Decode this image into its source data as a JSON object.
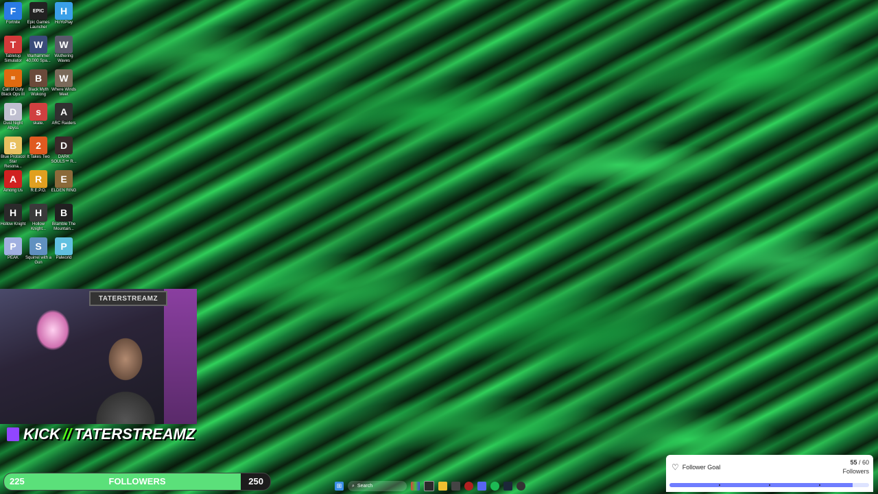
{
  "desktop": {
    "icons": [
      {
        "label": "Fortnite",
        "glyph": "F",
        "color": "#2a7be4"
      },
      {
        "label": "Epic Games Launcher",
        "glyph": "EPIC",
        "color": "#222222"
      },
      {
        "label": "HoYoPlay",
        "glyph": "H",
        "color": "#3aa0e8"
      },
      {
        "label": "Tabletop Simulator",
        "glyph": "T",
        "color": "#d33a3a"
      },
      {
        "label": "Warhammer 40,000 Spa...",
        "glyph": "W",
        "color": "#3a4c7a"
      },
      {
        "label": "Wuthering Waves",
        "glyph": "W",
        "color": "#5a5a6a"
      },
      {
        "label": "Call of Duty Black Ops III",
        "glyph": "III",
        "color": "#e06a10"
      },
      {
        "label": "Black Myth Wukong",
        "glyph": "B",
        "color": "#6a4a3a"
      },
      {
        "label": "Where Winds Meet",
        "glyph": "W",
        "color": "#7a6a5a"
      },
      {
        "label": "Dust Night Abyss",
        "glyph": "D",
        "color": "#c0c0d0"
      },
      {
        "label": "skate.",
        "glyph": "s",
        "color": "#d04040"
      },
      {
        "label": "ARC Raiders",
        "glyph": "A",
        "color": "#303030"
      },
      {
        "label": "Blue Protocol Star Resona...",
        "glyph": "B",
        "color": "#e8c060"
      },
      {
        "label": "It Takes Two",
        "glyph": "2",
        "color": "#e05a20"
      },
      {
        "label": "DARK SOULS™ R...",
        "glyph": "D",
        "color": "#3a2a2a"
      },
      {
        "label": "Among Us",
        "glyph": "A",
        "color": "#d02020"
      },
      {
        "label": "R.E.P.O.",
        "glyph": "R",
        "color": "#e0a020"
      },
      {
        "label": "ELDEN RING",
        "glyph": "E",
        "color": "#8a6a3a"
      },
      {
        "label": "Hollow Knight",
        "glyph": "H",
        "color": "#2a2a2a"
      },
      {
        "label": "Hollow Knight...",
        "glyph": "H",
        "color": "#3a3a3a"
      },
      {
        "label": "Bramble The Mountain...",
        "glyph": "B",
        "color": "#202020"
      },
      {
        "label": "PEAK",
        "glyph": "P",
        "color": "#a0b0e0"
      },
      {
        "label": "Squirrel with a Gun",
        "glyph": "S",
        "color": "#6090c0"
      },
      {
        "label": "Palworld",
        "glyph": "P",
        "color": "#60c0e0"
      }
    ]
  },
  "webcam": {
    "banner_text": "TATERSTREAMZ"
  },
  "overlay": {
    "kick_text": "KICK",
    "slashes": "//",
    "channel_name": "TATERSTREAMZ"
  },
  "follower_bar": {
    "start": "225",
    "label": "FOLLOWERS",
    "end": "250",
    "progress_fraction": 0.89
  },
  "taskbar": {
    "search_placeholder": "Search",
    "items": [
      "windows-start",
      "search",
      "browser",
      "task-view",
      "file-explorer",
      "calculator",
      "obs",
      "discord",
      "spotify",
      "steam",
      "settings"
    ]
  },
  "goal_widget": {
    "title": "Follower Goal",
    "current": "55",
    "separator": " / ",
    "target": "60",
    "unit": "Followers",
    "progress_fraction": 0.9167
  }
}
